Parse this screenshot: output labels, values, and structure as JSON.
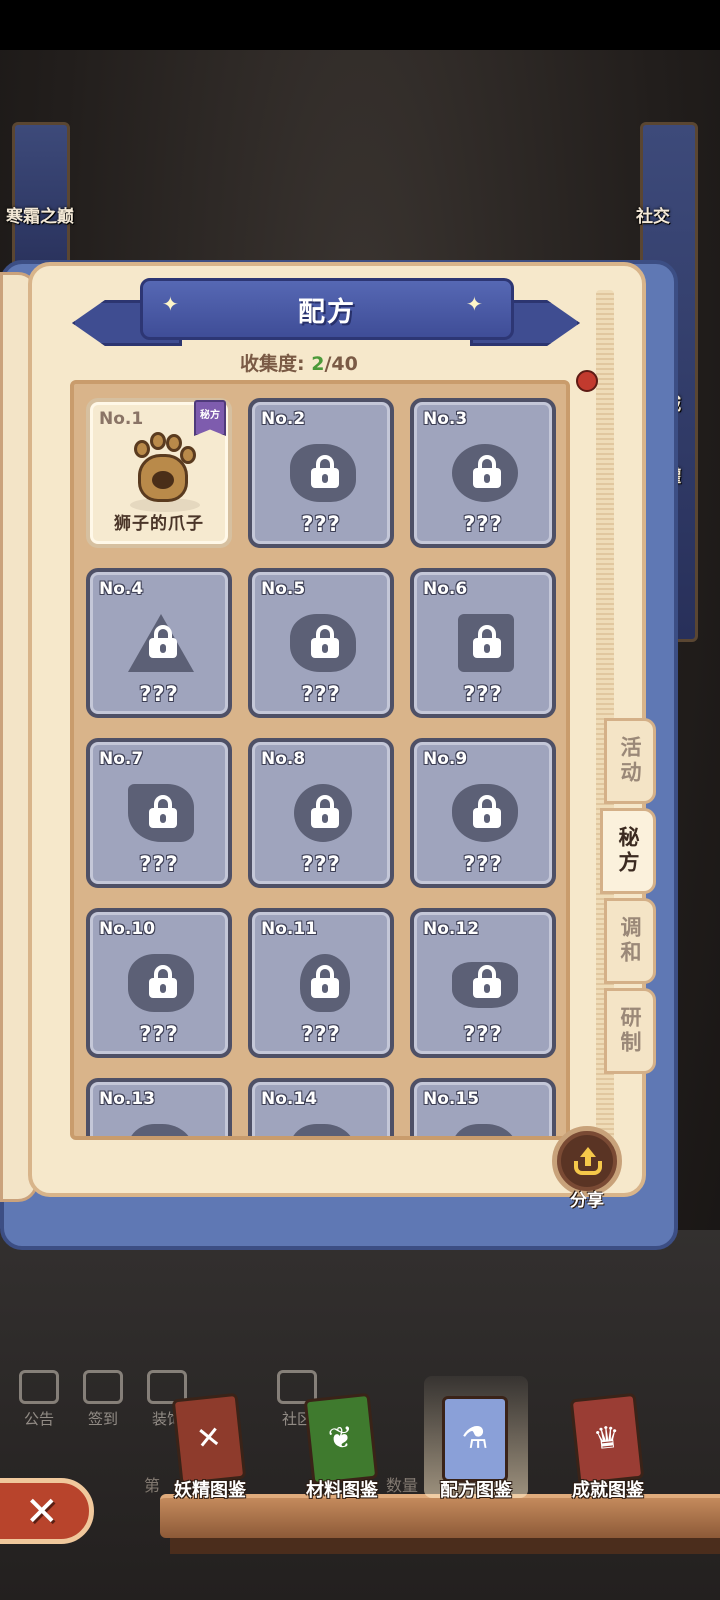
{
  "background": {
    "left_banner_label": "寒霜之巅",
    "right_labels": [
      "社交",
      "委托",
      "城",
      "罐"
    ],
    "nav_items": [
      "公告",
      "签到",
      "装饰",
      "社区"
    ],
    "misc_text": [
      "第",
      "数量"
    ]
  },
  "book": {
    "title": "配方",
    "collection_label": "收集度: ",
    "collection_count": "2",
    "collection_total": "/40",
    "tabs": [
      {
        "label": "活动",
        "active": false
      },
      {
        "label": "秘方",
        "active": true
      },
      {
        "label": "调和",
        "active": false
      },
      {
        "label": "研制",
        "active": false
      }
    ],
    "recipes": [
      {
        "no": "No.1",
        "name": "狮子的爪子",
        "unlocked": true,
        "badge": "秘方"
      },
      {
        "no": "No.2",
        "name": "???",
        "unlocked": false
      },
      {
        "no": "No.3",
        "name": "???",
        "unlocked": false
      },
      {
        "no": "No.4",
        "name": "???",
        "unlocked": false
      },
      {
        "no": "No.5",
        "name": "???",
        "unlocked": false
      },
      {
        "no": "No.6",
        "name": "???",
        "unlocked": false
      },
      {
        "no": "No.7",
        "name": "???",
        "unlocked": false
      },
      {
        "no": "No.8",
        "name": "???",
        "unlocked": false
      },
      {
        "no": "No.9",
        "name": "???",
        "unlocked": false
      },
      {
        "no": "No.10",
        "name": "???",
        "unlocked": false
      },
      {
        "no": "No.11",
        "name": "???",
        "unlocked": false
      },
      {
        "no": "No.12",
        "name": "???",
        "unlocked": false
      },
      {
        "no": "No.13",
        "name": "",
        "unlocked": false
      },
      {
        "no": "No.14",
        "name": "",
        "unlocked": false
      },
      {
        "no": "No.15",
        "name": "",
        "unlocked": false
      }
    ],
    "share_label": "分享"
  },
  "bottom_tabs": [
    {
      "label": "妖精图鉴",
      "color": "#8e3b2c",
      "active": false
    },
    {
      "label": "材料图鉴",
      "color": "#3f7a2e",
      "active": false
    },
    {
      "label": "配方图鉴",
      "color": "#8aa0d8",
      "active": true
    },
    {
      "label": "成就图鉴",
      "color": "#9a3d34",
      "active": false
    }
  ],
  "close_symbol": "✕",
  "colors": {
    "ribbon": "#4a59a6",
    "page": "#f6e8cb",
    "locked_cell": "#9fa4bd",
    "collected": "#4c9a3a"
  }
}
